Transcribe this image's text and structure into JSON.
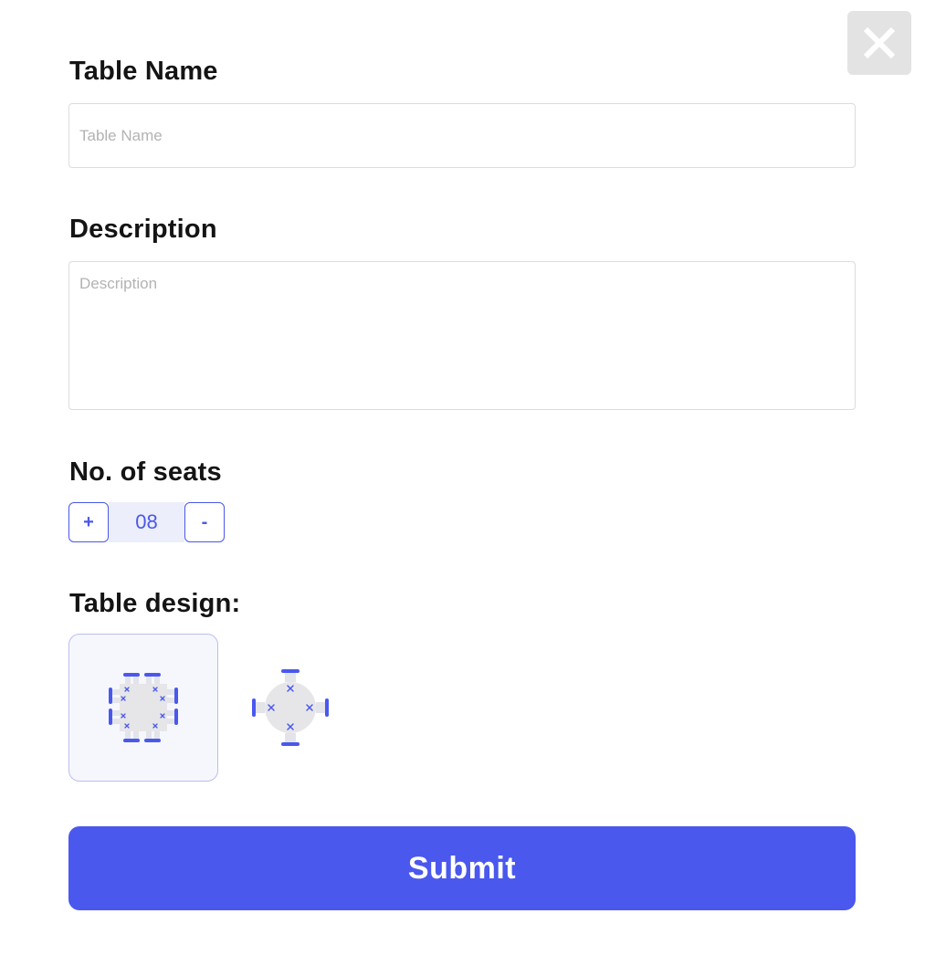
{
  "form": {
    "table_name_label": "Table Name",
    "table_name_placeholder": "Table Name",
    "table_name_value": "",
    "description_label": "Description",
    "description_placeholder": "Description",
    "description_value": "",
    "seats_label": "No. of seats",
    "seats_increment": "+",
    "seats_value": "08",
    "seats_decrement": "-",
    "design_label": "Table design:",
    "design_options": [
      {
        "icon": "square-table-icon",
        "selected": true
      },
      {
        "icon": "round-table-icon",
        "selected": false
      }
    ],
    "submit_label": "Submit"
  },
  "icons": {
    "close": "close-icon"
  },
  "colors": {
    "accent": "#4a58ee",
    "stepper_bg": "#eceefb",
    "close_bg": "#e3e3e3",
    "selected_card_bg": "#f6f7fc"
  }
}
